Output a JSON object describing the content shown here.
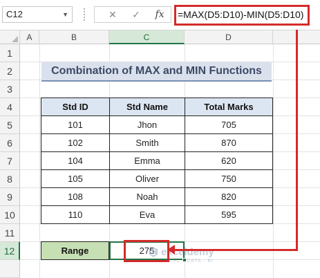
{
  "formula_bar": {
    "name_box": "C12",
    "cancel_symbol": "✕",
    "enter_symbol": "✓",
    "fx_label": "fx",
    "formula": "=MAX(D5:D10)-MIN(D5:D10)"
  },
  "columns": [
    "A",
    "B",
    "C",
    "D"
  ],
  "rows": [
    "1",
    "2",
    "3",
    "4",
    "5",
    "6",
    "7",
    "8",
    "9",
    "10",
    "11",
    "12"
  ],
  "selected_column": "C",
  "selected_row": "12",
  "sheet": {
    "title": "Combination of MAX and MIN Functions",
    "table": {
      "headers": [
        "Std ID",
        "Std Name",
        "Total Marks"
      ],
      "rows": [
        [
          "101",
          "Jhon",
          "705"
        ],
        [
          "102",
          "Smith",
          "870"
        ],
        [
          "104",
          "Emma",
          "620"
        ],
        [
          "105",
          "Oliver",
          "750"
        ],
        [
          "108",
          "Noah",
          "820"
        ],
        [
          "110",
          "Eva",
          "595"
        ]
      ]
    },
    "range_label": "Range",
    "range_value": "275"
  },
  "watermark": {
    "name": "exceldemy",
    "tagline": "EXCEL · DATA · BI"
  },
  "colors": {
    "highlight_red": "#d42a2a",
    "selection_green": "#217346",
    "header_fill": "#dce6f2",
    "range_fill": "#c6e0b4",
    "title_fill": "#dbe1ec"
  }
}
